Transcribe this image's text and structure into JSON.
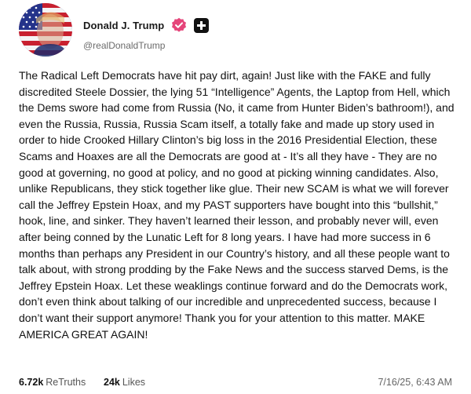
{
  "author": {
    "display_name": "Donald J. Trump",
    "handle": "@realDonaldTrump",
    "verified_icon": "verified-badge-icon",
    "app_icon": "truth-social-icon"
  },
  "post": {
    "text": "The Radical Left Democrats have hit pay dirt, again! Just like with the FAKE and fully discredited Steele Dossier, the lying 51 “Intelligence” Agents, the Laptop from Hell, which the Dems swore had come from Russia (No, it came from Hunter Biden’s bathroom!), and even the Russia, Russia, Russia Scam itself, a totally fake and made up story used in order to hide Crooked Hillary Clinton’s big loss in the 2016 Presidential Election, these Scams and Hoaxes are all the Democrats are good at - It’s all they have - They are no good at governing, no good at policy, and no good at picking winning candidates. Also, unlike Republicans, they stick together like glue. Their new SCAM is what we will forever call the Jeffrey Epstein Hoax, and my PAST supporters have bought into this “bullshit,” hook, line, and sinker. They haven’t learned their lesson, and probably never will, even after being conned by the Lunatic Left for 8 long years. I have had more success in 6 months than perhaps any President in our Country’s history, and all these people want to talk about, with strong prodding by the Fake News and the success starved Dems, is the Jeffrey Epstein Hoax. Let these weaklings continue forward and do the Democrats work, don’t even think about talking of our incredible and unprecedented success, because I don’t want their support anymore! Thank you for your attention to this matter. MAKE AMERICA GREAT AGAIN!"
  },
  "stats": {
    "retruths_count": "6.72k",
    "retruths_label": "ReTruths",
    "likes_count": "24k",
    "likes_label": "Likes"
  },
  "timestamp": "7/16/25, 6:43 AM",
  "colors": {
    "verified_badge": "#e5457a",
    "text": "#111111",
    "muted": "#6b6b6b"
  }
}
